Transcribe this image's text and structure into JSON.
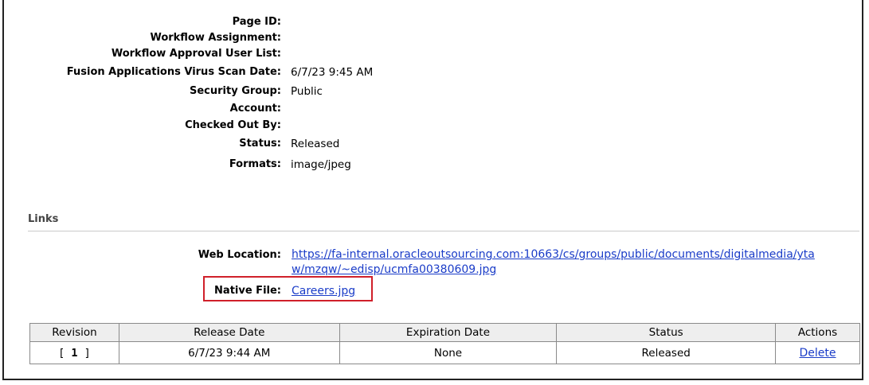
{
  "properties": [
    {
      "label": "Page ID:",
      "value": ""
    },
    {
      "label": "Workflow Assignment:",
      "value": ""
    },
    {
      "label": "Workflow Approval User List:",
      "value": ""
    },
    {
      "label": "Fusion Applications Virus Scan Date:",
      "value": "6/7/23 9:45 AM"
    },
    {
      "label": "Security Group:",
      "value": "Public"
    },
    {
      "label": "Account:",
      "value": ""
    },
    {
      "label": "Checked Out By:",
      "value": ""
    },
    {
      "label": "Status:",
      "value": "Released"
    },
    {
      "label": "Formats:",
      "value": "image/jpeg"
    }
  ],
  "links_section": {
    "title": "Links",
    "web_location_label": "Web Location:",
    "web_location_url": "https://fa-internal.oracleoutsourcing.com:10663/cs/groups/public/documents/digitalmedia/ytaw/mzqw/~edisp/ucmfa00380609.jpg",
    "native_file_label": "Native File:",
    "native_file_name": "Careers.jpg"
  },
  "revisions_table": {
    "headers": [
      "Revision",
      "Release Date",
      "Expiration Date",
      "Status",
      "Actions"
    ],
    "rows": [
      {
        "revision": "1",
        "release_date": "6/7/23 9:44 AM",
        "expiration_date": "None",
        "status": "Released",
        "action": "Delete"
      }
    ]
  }
}
